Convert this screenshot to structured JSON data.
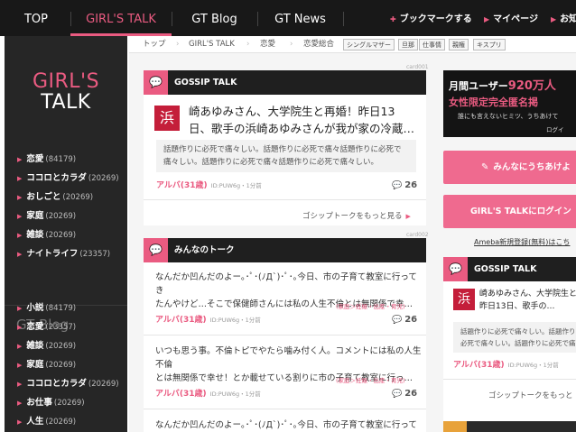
{
  "topnav": {
    "tabs": [
      "TOP",
      "GIRL'S TALK",
      "GT Blog",
      "GT News"
    ],
    "active_tab": "GIRL'S TALK",
    "bookmark": "ブックマークする",
    "mypage": "マイページ",
    "help": "お知"
  },
  "sidebar": {
    "logo_line1": "GIRL'S",
    "logo_line2": "TALK",
    "talk_categories": [
      {
        "label": "恋愛",
        "count": "(84179)"
      },
      {
        "label": "ココロとカラダ",
        "count": "(20269)"
      },
      {
        "label": "おしごと",
        "count": "(20269)"
      },
      {
        "label": "家庭",
        "count": "(20269)"
      },
      {
        "label": "雑談",
        "count": "(20269)"
      },
      {
        "label": "ナイトライフ",
        "count": "(23357)"
      }
    ],
    "blog_heading": "GT Blog",
    "blog_categories": [
      {
        "label": "小説",
        "count": "(84179)"
      },
      {
        "label": "恋愛",
        "count": "(23357)"
      },
      {
        "label": "雑談",
        "count": "(20269)"
      },
      {
        "label": "家庭",
        "count": "(20269)"
      },
      {
        "label": "ココロとカラダ",
        "count": "(20269)"
      },
      {
        "label": "お仕事",
        "count": "(20269)"
      },
      {
        "label": "人生",
        "count": "(20269)"
      }
    ]
  },
  "breadcrumb": {
    "items": [
      "トップ",
      "GIRL'S TALK",
      "恋愛",
      "恋愛総合"
    ],
    "tags": [
      "シングルマザー",
      "旦那",
      "仕事情",
      "親権",
      "キスプリ"
    ]
  },
  "gossip": {
    "card_id": "card001",
    "title": "GOSSIP TALK",
    "kanji": "浜",
    "headline_line1": "崎あゆみさん、大学院生と再婚！昨日13",
    "headline_line2": "日、歌手の浜崎あゆみさんが我が家の冷蔵…",
    "snippet_line1": "話題作りに必死で痛々しい。話題作りに必死で痛々話題作りに必死で",
    "snippet_line2": "痛々しい。話題作りに必死で痛々話題作りに必死で痛々しい。",
    "author": "アルバ(31歳)",
    "meta": "ID:PUW6g・1分前",
    "comments": "26",
    "more": "ゴシップトークをもっと見る"
  },
  "talk": {
    "card_id": "card002",
    "title": "みんなのトーク",
    "posts": [
      {
        "line1": "なんだか凹んだのよー｡･ﾟ･(ﾉД`)･ﾟ･｡今日、市の子育て教室に行ってき",
        "line2": "たんやけど…そこで保健師さんには私の人生不倫とは無関係で幸…",
        "tag": "(家庭＞妊娠・出産・育児)",
        "author": "アルバ(31歳)",
        "meta": "ID:PUW6g・1分前",
        "comments": "26"
      },
      {
        "line1": "いつも思う事。不倫トピでやたら噛み付く人。コメントには私の人生不倫",
        "line2": "とは無関係で幸せ！とか載せている割りに市の子育て教室に行っ…",
        "tag": "(家庭＞妊娠・出産・育児)",
        "author": "アルバ(31歳)",
        "meta": "ID:PUW6g・1分前",
        "comments": "26"
      },
      {
        "line1": "なんだか凹んだのよー｡･ﾟ･(ﾉД`)･ﾟ･｡今日、市の子育て教室に行ってき"
      }
    ]
  },
  "right": {
    "banner_line1_pre": "月間ユーザー",
    "banner_line1_num": "920万人",
    "banner_line2": "女性限定完全匿名掲",
    "banner_line3": "誰にも言えないヒミツ、うちあけて",
    "banner_line4": "ログイ",
    "post_button": "みんなにうちあけよ",
    "login_button": "GIRL'S TALKにログイン",
    "register_link": "Ameba新規登録(無料)はこち",
    "gossip_title": "GOSSIP TALK",
    "gossip_kanji": "浜",
    "gossip_headline_line1": "崎あゆみさん、大学院生と再",
    "gossip_headline_line2": "昨日13日、歌手の…",
    "gossip_snippet_line1": "話題作りに必死で痛々しい。話題作りに必",
    "gossip_snippet_line2": "必死で痛々しい。話題作りに必死で痛々し",
    "gossip_author": "アルバ(31歳)",
    "gossip_meta": "ID:PUW6g・1分前",
    "gossip_more": "ゴシップトークをもっと"
  },
  "colors": {
    "accent": "#ea5b81",
    "nav_bg": "#181818",
    "sidebar_bg": "#262626",
    "card_head_bg": "#1f1f1f"
  }
}
